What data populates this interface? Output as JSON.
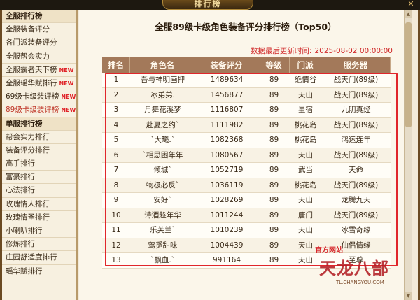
{
  "window": {
    "title": "排行榜",
    "close_glyph": "✕"
  },
  "sidebar": {
    "items": [
      {
        "label": "全服排行榜",
        "header": true,
        "new": ""
      },
      {
        "label": "全服装备评分",
        "header": false,
        "new": ""
      },
      {
        "label": "各门派装备评分",
        "header": false,
        "new": ""
      },
      {
        "label": "全服帮会实力",
        "header": false,
        "new": ""
      },
      {
        "label": "全服霸者天下榜",
        "header": false,
        "new": "NEW"
      },
      {
        "label": "全服瑶华赋排行",
        "header": false,
        "new": "NEW"
      },
      {
        "label": "69级卡级装评榜",
        "header": false,
        "new": "NEW"
      },
      {
        "label": "89级卡级装评榜",
        "header": false,
        "new": "NEW",
        "active": true
      },
      {
        "label": "单服排行榜",
        "header": true,
        "new": ""
      },
      {
        "label": "帮会实力排行",
        "header": false,
        "new": ""
      },
      {
        "label": "装备评分排行",
        "header": false,
        "new": ""
      },
      {
        "label": "高手排行",
        "header": false,
        "new": ""
      },
      {
        "label": "富豪排行",
        "header": false,
        "new": ""
      },
      {
        "label": "心法排行",
        "header": false,
        "new": ""
      },
      {
        "label": "玫瑰情人排行",
        "header": false,
        "new": ""
      },
      {
        "label": "玫瑰情圣排行",
        "header": false,
        "new": ""
      },
      {
        "label": "小喇叭排行",
        "header": false,
        "new": ""
      },
      {
        "label": "修炼排行",
        "header": false,
        "new": ""
      },
      {
        "label": "庄园舒适度排行",
        "header": false,
        "new": ""
      },
      {
        "label": "瑶华赋排行",
        "header": false,
        "new": ""
      }
    ]
  },
  "main": {
    "title": "全服89级卡级角色装备评分排行榜（Top50）",
    "updated_label": "数据最后更新时间:",
    "updated_value": "2025-08-02 00:00:00",
    "columns": [
      "排名",
      "角色名",
      "装备评分",
      "等级",
      "门派",
      "服务器"
    ],
    "rows": [
      [
        "1",
        "吾与神明画押",
        "1489634",
        "89",
        "绝情谷",
        "战天门(89级)"
      ],
      [
        "2",
        "冰弟弟.",
        "1456877",
        "89",
        "天山",
        "战天门(89级)"
      ],
      [
        "3",
        "月舞花溪梦",
        "1116807",
        "89",
        "星宿",
        "九阴真经"
      ],
      [
        "4",
        "赴夏之约`",
        "1111982",
        "89",
        "桃花岛",
        "战天门(89级)"
      ],
      [
        "5",
        "`大曦.`",
        "1082368",
        "89",
        "桃花岛",
        "鸿运连年"
      ],
      [
        "6",
        "`相思困年年",
        "1080567",
        "89",
        "天山",
        "战天门(89级)"
      ],
      [
        "7",
        "倾城`",
        "1052719",
        "89",
        "武当",
        "天命"
      ],
      [
        "8",
        "物极必反`",
        "1036119",
        "89",
        "桃花岛",
        "战天门(89级)"
      ],
      [
        "9",
        "安好`",
        "1028269",
        "89",
        "天山",
        "龙腾九天"
      ],
      [
        "10",
        "诗酒趁年华",
        "1011244",
        "89",
        "唐门",
        "战天门(89级)"
      ],
      [
        "11",
        "乐芙兰`",
        "1010239",
        "89",
        "天山",
        "冰雪奇缘"
      ],
      [
        "12",
        "莺觅甜味",
        "1004439",
        "89",
        "天山",
        "仙侣情缘"
      ],
      [
        "13",
        "`飘血.`",
        "991164",
        "89",
        "天山",
        "至尊"
      ]
    ]
  },
  "watermark": {
    "tag": "官方网站",
    "title": "天龙八部",
    "url": "TL.CHANGYOU.COM"
  },
  "colors": {
    "accent_red": "#e0262b",
    "header_brown": "#a3795a"
  },
  "icons": {
    "close": "close-icon",
    "scroll_up": "chevron-up-icon",
    "scroll_down": "chevron-down-icon"
  }
}
